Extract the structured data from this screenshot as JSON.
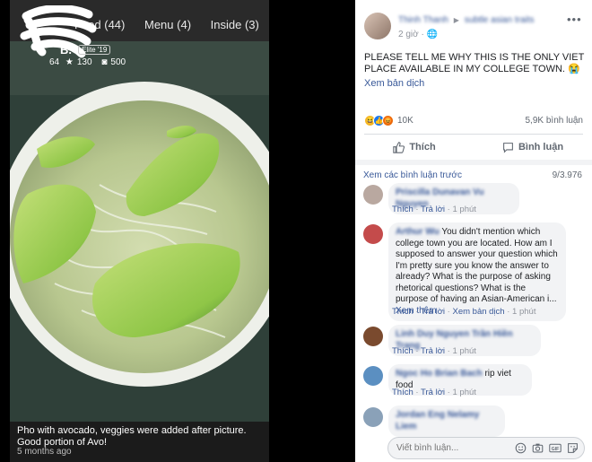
{
  "yelp": {
    "tabs": [
      "Food (44)",
      "Menu (4)",
      "Inside (3)"
    ],
    "user_name": "B.",
    "elite_badge": "Elite '19",
    "stats": [
      "64",
      "130",
      "500"
    ],
    "caption": "Pho with avocado, veggies were added after picture. Good portion of Avo!",
    "time_ago": "5 months ago"
  },
  "post": {
    "author": "Thinh Thanh",
    "group": "subtle asian traits",
    "time": "2 giờ",
    "text": "PLEASE TELL ME WHY THIS IS THE ONLY VIET PLACE AVAILABLE IN MY COLLEGE TOWN. 😭",
    "translate": "Xem bản dịch",
    "reactions_count": "10K",
    "comments_count": "5,9K bình luận",
    "like_label": "Thích",
    "comment_label": "Bình luận",
    "view_previous": "Xem các bình luận trước",
    "pager": "9/3.976"
  },
  "comments": [
    {
      "name": "Priscilla Dunavan Vu Nguyen",
      "text": "",
      "meta": [
        "Thích",
        "Trả lời",
        "1 phút"
      ]
    },
    {
      "name": "Arthur Wu",
      "text": "You didn't mention which college town you are located. How am I supposed to answer your question which I'm pretty sure you know the answer to already? What is the purpose of asking rhetorical questions? What is the purpose of having an Asian-American i...",
      "see_more": "Xem thêm",
      "meta": [
        "Thích",
        "Trả lời",
        "Xem bản dịch",
        "1 phút"
      ]
    },
    {
      "name": "Linh Duy Nguyen Trần Hiền Trang",
      "text": "",
      "meta": [
        "Thích",
        "Trả lời",
        "1 phút"
      ]
    },
    {
      "name": "Ngoc Ho Brian Bach",
      "text": "rip viet food",
      "meta": [
        "Thích",
        "Trả lời",
        "1 phút"
      ]
    },
    {
      "name": "Jordan Eng Nelamy Liem",
      "text": "",
      "meta": [
        "Thích",
        "Trả lời",
        "1 phút"
      ]
    }
  ],
  "composer": {
    "placeholder": "Viết bình luận..."
  },
  "colors": {
    "fb_link": "#385898",
    "fb_bg": "#ffffff",
    "yelp_bg": "#1b1b1b",
    "avocado": "#8fcf4a"
  },
  "icons": [
    "more-icon",
    "globe-icon",
    "like-icon",
    "comment-icon",
    "emoji-icon",
    "camera-icon",
    "gif-icon",
    "sticker-icon",
    "haha-reaction-icon",
    "like-reaction-icon",
    "angry-reaction-icon"
  ]
}
